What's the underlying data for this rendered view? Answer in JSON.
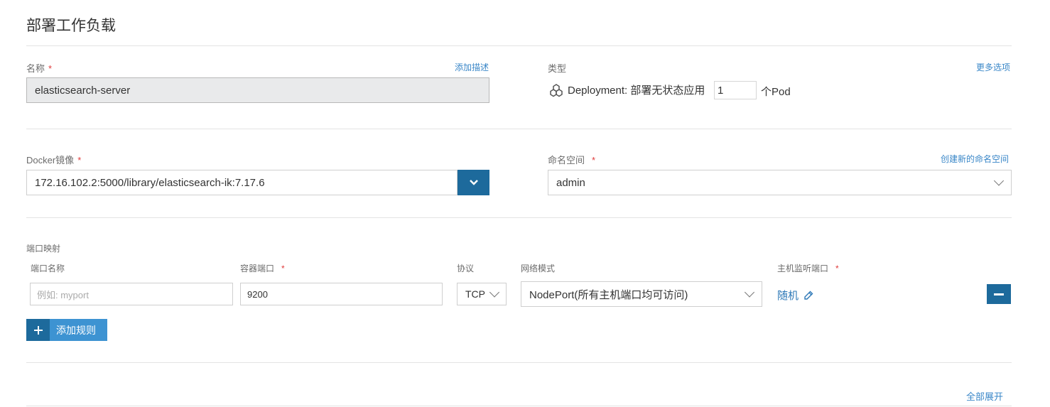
{
  "page": {
    "title": "部署工作负载"
  },
  "name_section": {
    "label": "名称",
    "required_mark": "*",
    "add_description_link": "添加描述",
    "value": "elasticsearch-server"
  },
  "type_section": {
    "label": "类型",
    "more_options_link": "更多选项",
    "deployment_label": "Deployment: 部署无状态应用",
    "replicas": "1",
    "pod_suffix": "个Pod"
  },
  "image_section": {
    "label": "Docker镜像",
    "required_mark": "*",
    "value": "172.16.102.2:5000/library/elasticsearch-ik:7.17.6"
  },
  "namespace_section": {
    "label": "命名空间",
    "required_mark": "*",
    "create_link": "创建新的命名空间",
    "value": "admin"
  },
  "ports_section": {
    "title": "端口映射",
    "columns": {
      "port_name": "端口名称",
      "container_port": "容器端口",
      "protocol": "协议",
      "network_mode": "网络模式",
      "host_port": "主机监听端口"
    },
    "required_mark": "*",
    "row": {
      "port_name_placeholder": "例如: myport",
      "container_port": "9200",
      "protocol": "TCP",
      "network_mode": "NodePort(所有主机端口均可访问)",
      "host_port": "随机"
    },
    "add_rule_button": "添加规则"
  },
  "footer": {
    "expand_all_link": "全部展开"
  },
  "colors": {
    "accent": "#1d6a9c",
    "link": "#3a87c8",
    "required": "#e03b3b"
  }
}
